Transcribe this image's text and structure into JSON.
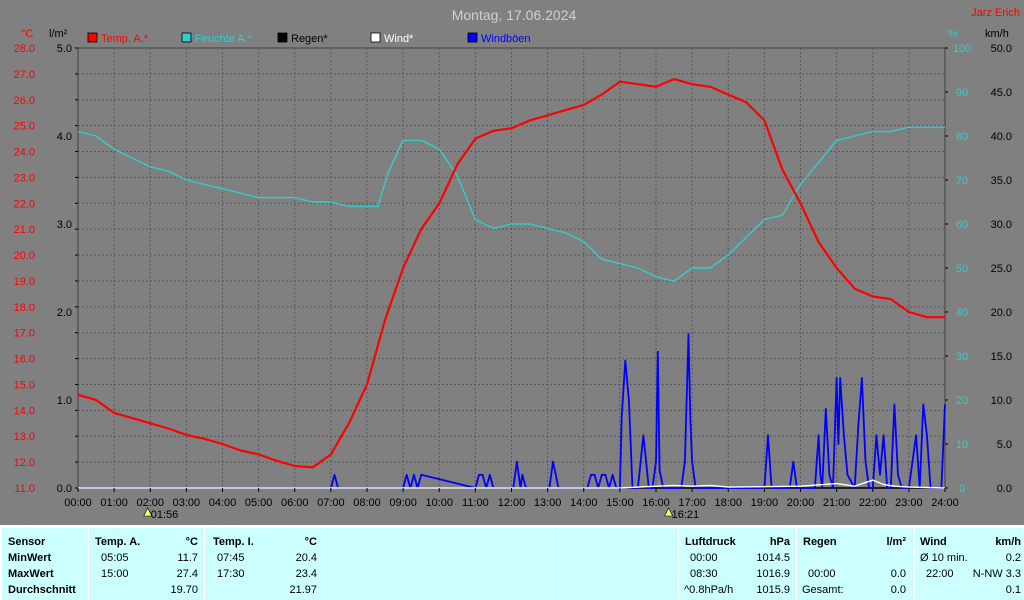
{
  "chart_data": {
    "type": "line",
    "title": "Montag, 17.06.2024",
    "author": "Jarz Erich",
    "axes": {
      "left_temp": {
        "unit": "°C",
        "min": 11.0,
        "max": 28.0,
        "ticks": [
          "28.0",
          "27.0",
          "26.0",
          "25.0",
          "24.0",
          "23.0",
          "22.0",
          "21.0",
          "20.0",
          "19.0",
          "18.0",
          "17.0",
          "16.0",
          "15.0",
          "14.0",
          "13.0",
          "12.0",
          "11.0"
        ]
      },
      "left_rain": {
        "unit": "l/m²",
        "min": 0.0,
        "max": 5.0,
        "ticks": [
          "5.0",
          "4.0",
          "3.0",
          "2.0",
          "1.0",
          "0.0"
        ]
      },
      "right_humidity": {
        "unit": "%",
        "min": 0,
        "max": 100,
        "ticks": [
          "100",
          "90",
          "80",
          "70",
          "60",
          "50",
          "40",
          "30",
          "20",
          "10",
          "0"
        ]
      },
      "right_wind": {
        "unit": "km/h",
        "min": 0.0,
        "max": 50.0,
        "ticks": [
          "50.0",
          "45.0",
          "40.0",
          "35.0",
          "30.0",
          "25.0",
          "20.0",
          "15.0",
          "10.0",
          "5.0",
          "0.0"
        ]
      },
      "x_ticks": [
        "00:00",
        "01:00",
        "02:00",
        "03:00",
        "04:00",
        "05:00",
        "06:00",
        "07:00",
        "08:00",
        "09:00",
        "10:00",
        "11:00",
        "12:00",
        "13:00",
        "14:00",
        "15:00",
        "16:00",
        "17:00",
        "18:00",
        "19:00",
        "20:00",
        "21:00",
        "22:00",
        "23:00",
        "24:00"
      ],
      "grid": true
    },
    "legend": [
      {
        "name": "Temp. A.*",
        "color": "#ff0000"
      },
      {
        "name": "Feuchte A.*",
        "color": "#33cccc"
      },
      {
        "name": "Regen*",
        "color": "#000000"
      },
      {
        "name": "Wind*",
        "color": "#ffffff"
      },
      {
        "name": "Windböen",
        "color": "#0000ff"
      }
    ],
    "sun_markers": [
      {
        "hour": 1.93,
        "label": "01:56"
      },
      {
        "hour": 16.35,
        "label": "16:21"
      }
    ],
    "series": [
      {
        "name": "Temp. A.*",
        "axis": "left_temp",
        "color": "#ff0000",
        "x": [
          0,
          0.5,
          1,
          1.5,
          2,
          2.5,
          3,
          3.5,
          4,
          4.5,
          5,
          5.5,
          6,
          6.5,
          7,
          7.5,
          8,
          8.5,
          9,
          9.5,
          10,
          10.5,
          11,
          11.5,
          12,
          12.5,
          13,
          13.5,
          14,
          14.5,
          15,
          15.5,
          16,
          16.5,
          17,
          17.5,
          18,
          18.5,
          19,
          19.5,
          20,
          20.5,
          21,
          21.5,
          22,
          22.5,
          23,
          23.5,
          24
        ],
        "values": [
          14.6,
          14.4,
          13.9,
          13.7,
          13.5,
          13.3,
          13.05,
          12.9,
          12.7,
          12.45,
          12.3,
          12.05,
          11.85,
          11.8,
          12.3,
          13.5,
          15.0,
          17.5,
          19.5,
          21.0,
          22.0,
          23.5,
          24.5,
          24.8,
          24.9,
          25.2,
          25.4,
          25.6,
          25.8,
          26.2,
          26.7,
          26.6,
          26.5,
          26.8,
          26.6,
          26.5,
          26.2,
          25.9,
          25.2,
          23.3,
          22.0,
          20.5,
          19.5,
          18.7,
          18.4,
          18.3,
          17.8,
          17.6,
          17.6
        ]
      },
      {
        "name": "Feuchte A.*",
        "axis": "right_humidity",
        "color": "#33cccc",
        "x": [
          0,
          0.5,
          1,
          1.5,
          2,
          2.5,
          3,
          3.5,
          4,
          4.5,
          5,
          5.5,
          6,
          6.5,
          7,
          7.5,
          8,
          8.3,
          8.6,
          9,
          9.5,
          10,
          10.5,
          11,
          11.5,
          12,
          12.5,
          13,
          13.5,
          14,
          14.5,
          15,
          15.5,
          16,
          16.5,
          17,
          17.5,
          18,
          18.5,
          19,
          19.5,
          20,
          20.5,
          21,
          21.5,
          22,
          22.5,
          23,
          23.5,
          24
        ],
        "values": [
          81,
          80,
          77,
          75,
          73,
          72,
          70,
          69,
          68,
          67,
          66,
          66,
          66,
          65,
          65,
          64,
          64,
          64,
          72,
          79,
          79,
          77,
          71,
          61,
          59,
          60,
          60,
          59,
          58,
          56,
          52,
          51,
          50,
          48,
          47,
          50,
          50,
          53,
          57,
          61,
          62,
          69,
          74,
          79,
          80,
          81,
          81,
          82,
          82,
          82
        ]
      },
      {
        "name": "Regen*",
        "axis": "left_rain",
        "color": "#000000",
        "x": [
          0,
          24
        ],
        "values": [
          0,
          0
        ]
      },
      {
        "name": "Wind*",
        "axis": "right_wind",
        "color": "#ffffff",
        "x": [
          0,
          15,
          16,
          16.5,
          17,
          17.5,
          18,
          20,
          21,
          21.5,
          22,
          22.3,
          22.6,
          23,
          24
        ],
        "values": [
          0,
          0,
          0.2,
          0.3,
          0.2,
          0.3,
          0.1,
          0.2,
          0.5,
          0.2,
          0.9,
          0.4,
          0.2,
          0.1,
          0
        ]
      },
      {
        "name": "Windböen",
        "axis": "right_wind",
        "color": "#0000ff",
        "x": [
          0,
          7.0,
          7.1,
          7.2,
          9.0,
          9.1,
          9.2,
          9.3,
          9.4,
          9.5,
          11.0,
          11.1,
          11.2,
          11.3,
          11.4,
          11.5,
          12.05,
          12.15,
          12.25,
          12.3,
          12.4,
          12.5,
          13.05,
          13.15,
          13.3,
          14.1,
          14.2,
          14.3,
          14.4,
          14.5,
          14.6,
          14.7,
          14.8,
          14.9,
          15.0,
          15.05,
          15.15,
          15.25,
          15.35,
          15.5,
          15.5,
          15.65,
          15.8,
          15.95,
          15.9,
          16.0,
          16.05,
          16.1,
          16.2,
          16.7,
          16.8,
          16.9,
          16.95,
          17.0,
          17.1,
          17.2,
          17.25,
          19.0,
          19.1,
          19.2,
          19.7,
          19.8,
          19.9,
          20.4,
          20.5,
          20.55,
          20.6,
          20.7,
          20.8,
          20.9,
          21.0,
          21.05,
          21.1,
          21.2,
          21.3,
          21.5,
          21.6,
          21.7,
          21.8,
          21.9,
          22.0,
          22.1,
          22.2,
          22.3,
          22.4,
          22.5,
          22.6,
          22.7,
          22.8,
          22.9,
          23.0,
          23.2,
          23.3,
          23.4,
          23.5,
          23.6,
          23.7,
          23.9,
          24.0
        ],
        "values": [
          0,
          0,
          1.5,
          0,
          0,
          1.5,
          0,
          1.5,
          0,
          1.5,
          0,
          1.5,
          1.5,
          0,
          1.5,
          0,
          0,
          3.0,
          0,
          1.5,
          0,
          0,
          0,
          3.0,
          0,
          0,
          1.5,
          1.5,
          0,
          1.5,
          1.5,
          0,
          1.5,
          0,
          0,
          8.0,
          14.5,
          10.0,
          0,
          0,
          0,
          6.0,
          0,
          0,
          0,
          3.0,
          15.5,
          2.0,
          0,
          0,
          3.0,
          17.5,
          8.0,
          3.0,
          0,
          0,
          0,
          0,
          6.0,
          0,
          0,
          3.0,
          0,
          0,
          6.0,
          1.5,
          0,
          9.0,
          1.5,
          0,
          12.5,
          5.0,
          12.5,
          6.0,
          1.5,
          0,
          7.0,
          12.5,
          3.0,
          0,
          0,
          6.0,
          1.5,
          6.0,
          0,
          0,
          9.5,
          1.5,
          0,
          0,
          0,
          6.0,
          0,
          9.5,
          6.0,
          0,
          0,
          0,
          9.5
        ]
      }
    ]
  },
  "table": {
    "sensor": {
      "header": "Sensor",
      "rows": [
        "MinWert",
        "MaxWert",
        "Durchschnitt"
      ]
    },
    "temp_a": {
      "header": "Temp. A.",
      "unit": "°C",
      "times": [
        "05:05",
        "15:00",
        ""
      ],
      "values": [
        "11.7",
        "27.4",
        "19.70"
      ]
    },
    "temp_i": {
      "header": "Temp. I.",
      "unit": "°C",
      "times": [
        "07:45",
        "17:30",
        ""
      ],
      "values": [
        "20.4",
        "23.4",
        "21.97"
      ]
    },
    "luftdruck": {
      "header": "Luftdruck",
      "unit": "hPa",
      "times": [
        "00:00",
        "08:30",
        "^0.8hPa/h"
      ],
      "values": [
        "1014.5",
        "1016.9",
        "1015.9"
      ]
    },
    "regen": {
      "header": "Regen",
      "unit": "l/m²",
      "times": [
        "",
        "00:00",
        "Gesamt:"
      ],
      "values": [
        "",
        "0.0",
        "0.0"
      ]
    },
    "wind": {
      "header": "Wind",
      "unit": "km/h",
      "times": [
        "Ø 10 min.",
        "22:00",
        ""
      ],
      "values": [
        "0.2",
        "N-NW 3.3",
        "0.1"
      ]
    }
  }
}
